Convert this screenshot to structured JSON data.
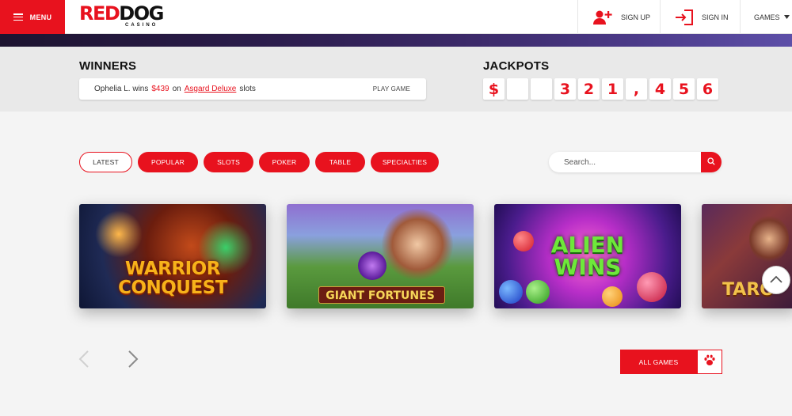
{
  "header": {
    "menu_label": "MENU",
    "logo": {
      "part1": "RED",
      "part2": "DOG",
      "sub": "CASINO"
    },
    "sign_up": "SIGN UP",
    "sign_in": "SIGN IN",
    "games": "GAMES"
  },
  "winners": {
    "title": "WINNERS",
    "name_prefix": "Ophelia L. wins",
    "amount": "$439",
    "on": "on",
    "game": "Asgard Deluxe",
    "suffix": "slots",
    "play_label": "PLAY GAME"
  },
  "jackpots": {
    "title": "JACKPOTS",
    "digits": [
      "$",
      "",
      "",
      "3",
      "2",
      "1",
      ",",
      "4",
      "5",
      "6"
    ]
  },
  "filters": [
    "LATEST",
    "POPULAR",
    "SLOTS",
    "POKER",
    "TABLE",
    "SPECIALTIES"
  ],
  "active_filter": "LATEST",
  "search": {
    "placeholder": "Search..."
  },
  "games": [
    {
      "title_line1": "WARRIOR",
      "title_line2": "CONQUEST"
    },
    {
      "title_line1": "GIANT FORTUNES"
    },
    {
      "title_line1": "ALIEN",
      "title_line2": "WINS"
    },
    {
      "title_line1": "TARO"
    }
  ],
  "all_games_label": "ALL GAMES",
  "colors": {
    "accent": "#e8121e"
  },
  "icons": {
    "menu": "hamburger-icon",
    "sign_up": "user-plus-icon",
    "sign_in": "sign-in-icon",
    "games": "chevron-down-icon",
    "search": "search-icon",
    "scroll_top": "chevron-up-icon",
    "prev": "chevron-left-icon",
    "next": "chevron-right-icon",
    "all_games": "paw-icon"
  }
}
